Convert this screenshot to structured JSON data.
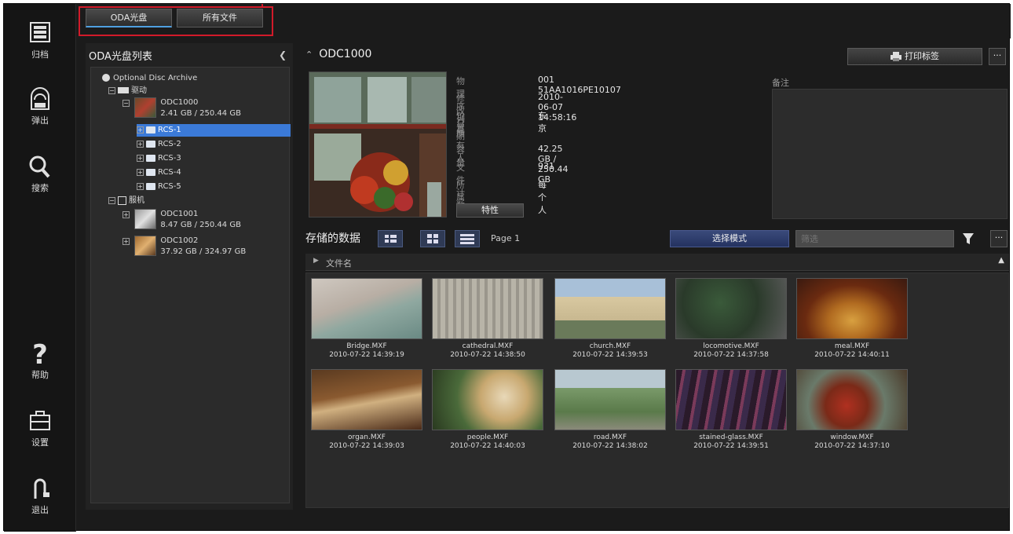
{
  "top_tabs": [
    {
      "label": "ODA光盘"
    },
    {
      "label": "所有文件"
    }
  ],
  "rail": [
    {
      "label": "归档",
      "icon": "archive-icon"
    },
    {
      "label": "弹出",
      "icon": "eject-icon"
    },
    {
      "label": "搜索",
      "icon": "search-icon"
    },
    {
      "label": "帮助",
      "icon": "help-icon"
    },
    {
      "label": "设置",
      "icon": "toolbox-icon"
    },
    {
      "label": "退出",
      "icon": "exit-icon"
    }
  ],
  "tree": {
    "title": "ODA光盘列表",
    "root": "Optional Disc Archive",
    "drive1": "驱动",
    "disc1_name": "ODC1000",
    "disc1_size": "2.41 GB / 250.44 GB",
    "folders": [
      "RCS-1",
      "RCS-2",
      "RCS-3",
      "RCS-4",
      "RCS-5"
    ],
    "drive2": "服机",
    "disc2_name": "ODC1001",
    "disc2_size": "8.47 GB / 250.44 GB",
    "disc3_name": "ODC1002",
    "disc3_size": "37.92 GB / 324.97 GB"
  },
  "main": {
    "disc_title": "ODC1000",
    "print_label": "打印标签",
    "more_label": "···",
    "props": [
      {
        "key": "物理序列号",
        "value": "001 51AA1016PE10107"
      },
      {
        "key": "修改日期",
        "value": "2010-06-07 14:58:16"
      },
      {
        "key": "位置",
        "value": "东京"
      },
      {
        "key": "所有人",
        "value": ""
      },
      {
        "key": "容量",
        "value": "42.25 GB / 250.44 GB"
      },
      {
        "key": "文件计数",
        "value": "931"
      },
      {
        "key": "所属",
        "value": "每个人"
      }
    ],
    "detail_label": "特性",
    "memo_label": "备注"
  },
  "stored": {
    "title": "存储的数据",
    "page_label": "Page 1",
    "select_mode": "选择模式",
    "filter_placeholder": "筛选",
    "column_header": "文件名",
    "files": [
      {
        "name": "Bridge.MXF",
        "date": "2010-07-22 14:39:19"
      },
      {
        "name": "cathedral.MXF",
        "date": "2010-07-22 14:38:50"
      },
      {
        "name": "church.MXF",
        "date": "2010-07-22 14:39:53"
      },
      {
        "name": "locomotive.MXF",
        "date": "2010-07-22 14:37:58"
      },
      {
        "name": "meal.MXF",
        "date": "2010-07-22 14:40:11"
      },
      {
        "name": "organ.MXF",
        "date": "2010-07-22 14:39:03"
      },
      {
        "name": "people.MXF",
        "date": "2010-07-22 14:40:03"
      },
      {
        "name": "road.MXF",
        "date": "2010-07-22 14:38:02"
      },
      {
        "name": "stained-glass.MXF",
        "date": "2010-07-22 14:39:51"
      },
      {
        "name": "window.MXF",
        "date": "2010-07-22 14:37:10"
      }
    ]
  },
  "colors": {
    "accent_blue": "#3b7ad8",
    "highlight_red": "#d21a2a"
  }
}
